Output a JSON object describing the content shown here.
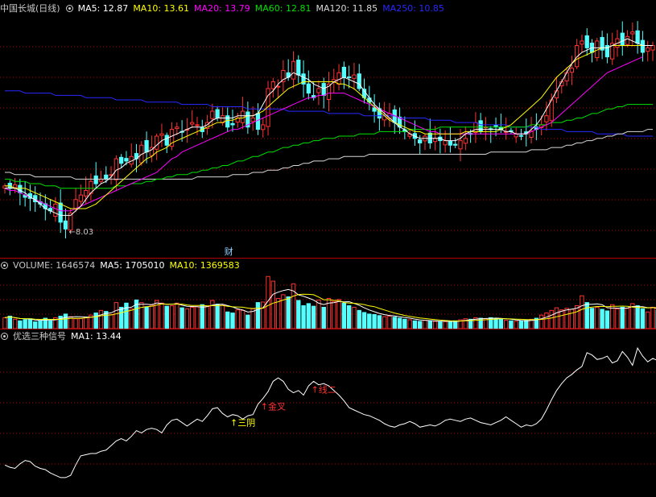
{
  "main_header": {
    "stock_name": "中国长城(日线)",
    "ma5": "MA5: 12.87",
    "ma10": "MA10: 13.61",
    "ma20": "MA20: 13.79",
    "ma60": "MA60: 12.81",
    "ma120": "MA120: 11.85",
    "ma250": "MA250: 10.85"
  },
  "vol_header": {
    "volume": "VOLUME: 1646574",
    "ma5": "MA5: 1705010",
    "ma10": "MA10: 1369583"
  },
  "ind_header": {
    "name": "优选三种信号",
    "ma1": "MA1: 13.44"
  },
  "colors": {
    "up": "#ff3232",
    "down": "#54ffff",
    "ma5": "#ffffff",
    "ma10": "#ffff00",
    "ma20": "#ff00ff",
    "ma60": "#00e000",
    "ma120": "#d8d8d8",
    "ma250": "#2828ff",
    "grid": "#b40000"
  },
  "chart_data": [
    {
      "type": "candlestick",
      "title": "中国长城(日线)",
      "ylim": [
        7.0,
        17.6
      ],
      "low_marker": {
        "label": "←8.03",
        "value": 8.03
      },
      "event_marker": {
        "label": "财",
        "x": 44
      },
      "close": [
        10.1,
        10.0,
        10.15,
        9.8,
        9.6,
        9.55,
        9.4,
        9.3,
        9.1,
        9.0,
        9.3,
        8.5,
        8.2,
        8.9,
        9.5,
        9.7,
        9.9,
        10.3,
        10.2,
        10.4,
        10.4,
        10.6,
        11.3,
        11.1,
        11.2,
        11.4,
        11.3,
        11.9,
        11.6,
        11.8,
        12.3,
        12.4,
        11.9,
        12.6,
        12.7,
        12.5,
        12.6,
        12.9,
        12.8,
        12.5,
        12.9,
        13.4,
        13.1,
        13.2,
        12.7,
        12.8,
        13.1,
        13.4,
        12.7,
        13.1,
        12.6,
        12.8,
        14.4,
        14.7,
        14.5,
        15.2,
        14.9,
        15.6,
        15.0,
        14.6,
        14.2,
        14.0,
        14.4,
        14.1,
        14.6,
        14.8,
        15.1,
        14.9,
        14.9,
        15.0,
        14.4,
        14.0,
        13.8,
        13.4,
        13.1,
        13.2,
        13.3,
        12.9,
        12.7,
        12.5,
        12.4,
        12.2,
        12.0,
        12.3,
        12.0,
        12.2,
        12.1,
        12.1,
        11.9,
        11.9,
        12.1,
        12.2,
        12.4,
        12.9,
        12.5,
        12.7,
        12.6,
        12.7,
        12.6,
        12.5,
        12.5,
        12.4,
        12.3,
        12.4,
        12.5,
        12.6,
        12.8,
        13.2,
        13.9,
        14.3,
        14.7,
        15.1,
        15.3,
        16.3,
        16.5,
        16.2,
        16.0,
        16.5,
        16.1,
        15.8,
        16.4,
        16.6,
        16.3,
        16.7,
        16.9,
        16.4,
        16.0,
        16.2,
        16.3
      ],
      "ma": {
        "ma5": [
          10.0,
          10.0,
          10.0,
          9.9,
          9.8,
          9.6,
          9.5,
          9.3,
          9.1,
          9.0,
          8.9,
          8.8,
          8.8,
          8.8,
          9.0,
          9.2,
          9.5,
          9.8,
          10.0,
          10.2,
          10.3,
          10.5,
          10.8,
          10.9,
          11.1,
          11.2,
          11.3,
          11.5,
          11.6,
          11.7,
          11.9,
          12.1,
          12.2,
          12.3,
          12.4,
          12.5,
          12.6,
          12.7,
          12.7,
          12.7,
          12.8,
          13.0,
          13.1,
          13.1,
          13.1,
          13.1,
          13.2,
          13.2,
          13.2,
          13.2,
          13.3,
          13.7,
          14.1,
          14.3,
          14.6,
          14.8,
          14.9,
          15.1,
          15.0,
          14.9,
          14.8,
          14.6,
          14.5,
          14.4,
          14.5,
          14.7,
          14.8,
          14.9,
          14.8,
          14.7,
          14.6,
          14.3,
          14.0,
          13.7,
          13.5,
          13.3,
          13.1,
          12.9,
          12.7,
          12.6,
          12.4,
          12.3,
          12.2,
          12.2,
          12.2,
          12.2,
          12.2,
          12.1,
          12.1,
          12.1,
          12.2,
          12.4,
          12.5,
          12.6,
          12.6,
          12.6,
          12.6,
          12.6,
          12.6,
          12.5,
          12.5,
          12.4,
          12.4,
          12.4,
          12.6,
          12.8,
          13.1,
          13.5,
          13.9,
          14.3,
          14.7,
          15.1,
          15.5,
          15.8,
          16.0,
          16.1,
          16.2,
          16.2,
          16.2,
          16.2,
          16.3,
          16.4,
          16.5,
          16.6,
          16.5,
          16.4,
          16.3,
          16.3,
          16.3
        ],
        "ma10": [
          10.1,
          10.1,
          10.0,
          10.0,
          10.0,
          9.9,
          9.8,
          9.7,
          9.6,
          9.5,
          9.4,
          9.3,
          9.2,
          9.1,
          9.1,
          9.1,
          9.1,
          9.2,
          9.3,
          9.5,
          9.7,
          9.9,
          10.1,
          10.3,
          10.5,
          10.7,
          10.9,
          11.1,
          11.3,
          11.4,
          11.6,
          11.7,
          11.8,
          12.0,
          12.1,
          12.2,
          12.3,
          12.4,
          12.5,
          12.6,
          12.7,
          12.8,
          12.9,
          12.9,
          13.0,
          13.0,
          13.1,
          13.1,
          13.2,
          13.2,
          13.3,
          13.4,
          13.6,
          13.8,
          14.0,
          14.2,
          14.4,
          14.5,
          14.6,
          14.7,
          14.7,
          14.7,
          14.7,
          14.7,
          14.7,
          14.7,
          14.6,
          14.6,
          14.5,
          14.4,
          14.2,
          14.0,
          13.8,
          13.6,
          13.4,
          13.2,
          13.0,
          12.9,
          12.8,
          12.7,
          12.6,
          12.5,
          12.5,
          12.4,
          12.4,
          12.4,
          12.4,
          12.4,
          12.4,
          12.4,
          12.4,
          12.5,
          12.5,
          12.5,
          12.5,
          12.5,
          12.5,
          12.5,
          12.6,
          12.7,
          12.8,
          13.0,
          13.2,
          13.4,
          13.6,
          13.8,
          14.0,
          14.3,
          14.6,
          14.9,
          15.1,
          15.3,
          15.5,
          15.7,
          15.8,
          15.9,
          16.0,
          16.1,
          16.2,
          16.2,
          16.3,
          16.3,
          16.3,
          16.3,
          16.3,
          16.3,
          16.3
        ],
        "ma20": [
          10.0,
          9.9,
          9.9,
          9.8,
          9.7,
          9.6,
          9.5,
          9.4,
          9.3,
          9.2,
          9.1,
          9.0,
          9.0,
          9.0,
          9.1,
          9.2,
          9.3,
          9.4,
          9.5,
          9.6,
          9.7,
          9.8,
          9.9,
          10.0,
          10.1,
          10.2,
          10.3,
          10.4,
          10.5,
          10.6,
          10.7,
          10.9,
          11.1,
          11.3,
          11.4,
          11.6,
          11.7,
          11.8,
          11.9,
          12.0,
          12.1,
          12.2,
          12.3,
          12.4,
          12.5,
          12.6,
          12.6,
          12.7,
          12.8,
          12.9,
          13.0,
          13.1,
          13.2,
          13.3,
          13.4,
          13.5,
          13.6,
          13.7,
          13.8,
          13.9,
          14.0,
          14.0,
          14.1,
          14.1,
          14.2,
          14.2,
          14.2,
          14.2,
          14.1,
          14.0,
          13.9,
          13.8,
          13.7,
          13.6,
          13.5,
          13.4,
          13.3,
          13.2,
          13.1,
          13.0,
          12.9,
          12.8,
          12.7,
          12.6,
          12.5,
          12.5,
          12.4,
          12.4,
          12.4,
          12.4,
          12.4,
          12.4,
          12.4,
          12.4,
          12.4,
          12.4,
          12.4,
          12.4,
          12.4,
          12.4,
          12.4,
          12.4,
          12.4,
          12.4,
          12.5,
          12.6,
          12.7,
          12.8,
          12.9,
          13.1,
          13.3,
          13.5,
          13.7,
          13.9,
          14.1,
          14.3,
          14.5,
          14.7,
          14.9,
          15.1,
          15.2,
          15.3,
          15.4,
          15.5,
          15.6,
          15.7,
          15.8
        ],
        "ma60": [
          10.4,
          10.4,
          10.3,
          10.3,
          10.3,
          10.2,
          10.2,
          10.2,
          10.1,
          10.1,
          10.1,
          10.0,
          10.0,
          10.0,
          10.0,
          10.0,
          10.0,
          10.0,
          10.0,
          10.0,
          10.0,
          10.0,
          10.1,
          10.1,
          10.1,
          10.2,
          10.2,
          10.2,
          10.3,
          10.3,
          10.4,
          10.4,
          10.5,
          10.5,
          10.6,
          10.6,
          10.6,
          10.7,
          10.7,
          10.8,
          10.8,
          10.9,
          10.9,
          11.0,
          11.0,
          11.1,
          11.2,
          11.2,
          11.3,
          11.4,
          11.4,
          11.5,
          11.6,
          11.6,
          11.7,
          11.8,
          11.8,
          11.9,
          11.9,
          12.0,
          12.0,
          12.1,
          12.1,
          12.2,
          12.2,
          12.2,
          12.3,
          12.3,
          12.3,
          12.3,
          12.4,
          12.4,
          12.4,
          12.4,
          12.5,
          12.5,
          12.5,
          12.5,
          12.5,
          12.5,
          12.6,
          12.6,
          12.6,
          12.6,
          12.6,
          12.6,
          12.7,
          12.7,
          12.7,
          12.7,
          12.7,
          12.7,
          12.7,
          12.7,
          12.7,
          12.7,
          12.7,
          12.7,
          12.7,
          12.7,
          12.7,
          12.7,
          12.7,
          12.7,
          12.8,
          12.8,
          12.8,
          12.8,
          12.9,
          12.9,
          12.9,
          13.0,
          13.0,
          13.1,
          13.1,
          13.2,
          13.3,
          13.3,
          13.4,
          13.5,
          13.5,
          13.6,
          13.6,
          13.7,
          13.7,
          13.7,
          13.7,
          13.7,
          13.7
        ],
        "ma120": [
          10.7,
          10.7,
          10.6,
          10.6,
          10.6,
          10.6,
          10.5,
          10.5,
          10.5,
          10.5,
          10.5,
          10.5,
          10.5,
          10.5,
          10.4,
          10.4,
          10.4,
          10.4,
          10.4,
          10.4,
          10.4,
          10.4,
          10.4,
          10.4,
          10.4,
          10.4,
          10.4,
          10.4,
          10.4,
          10.4,
          10.4,
          10.4,
          10.4,
          10.4,
          10.4,
          10.4,
          10.4,
          10.4,
          10.5,
          10.5,
          10.5,
          10.5,
          10.5,
          10.5,
          10.5,
          10.6,
          10.6,
          10.6,
          10.6,
          10.7,
          10.7,
          10.7,
          10.8,
          10.8,
          10.8,
          10.9,
          10.9,
          11.0,
          11.0,
          11.1,
          11.1,
          11.2,
          11.2,
          11.2,
          11.3,
          11.3,
          11.3,
          11.4,
          11.4,
          11.4,
          11.4,
          11.4,
          11.5,
          11.5,
          11.5,
          11.5,
          11.5,
          11.5,
          11.5,
          11.5,
          11.5,
          11.5,
          11.5,
          11.5,
          11.5,
          11.5,
          11.5,
          11.5,
          11.5,
          11.5,
          11.5,
          11.5,
          11.5,
          11.5,
          11.5,
          11.5,
          11.6,
          11.6,
          11.6,
          11.6,
          11.6,
          11.6,
          11.6,
          11.6,
          11.7,
          11.7,
          11.7,
          11.7,
          11.8,
          11.8,
          11.8,
          11.9,
          11.9,
          12.0,
          12.0,
          12.1,
          12.1,
          12.2,
          12.2,
          12.3,
          12.3,
          12.4,
          12.4,
          12.5,
          12.5,
          12.5,
          12.5,
          12.6,
          12.6
        ],
        "ma250": [
          14.3,
          14.3,
          14.3,
          14.3,
          14.2,
          14.2,
          14.2,
          14.2,
          14.2,
          14.2,
          14.1,
          14.1,
          14.1,
          14.1,
          14.1,
          14.1,
          14.0,
          14.0,
          14.0,
          14.0,
          14.0,
          14.0,
          13.9,
          13.9,
          13.9,
          13.9,
          13.9,
          13.9,
          13.8,
          13.8,
          13.8,
          13.8,
          13.8,
          13.8,
          13.8,
          13.7,
          13.7,
          13.7,
          13.7,
          13.7,
          13.7,
          13.6,
          13.6,
          13.6,
          13.6,
          13.6,
          13.6,
          13.6,
          13.5,
          13.5,
          13.5,
          13.5,
          13.5,
          13.5,
          13.5,
          13.5,
          13.4,
          13.4,
          13.4,
          13.4,
          13.4,
          13.4,
          13.4,
          13.4,
          13.3,
          13.3,
          13.3,
          13.3,
          13.3,
          13.3,
          13.3,
          13.2,
          13.2,
          13.2,
          13.2,
          13.2,
          13.2,
          13.2,
          13.1,
          13.1,
          13.1,
          13.1,
          13.1,
          13.1,
          13.0,
          13.0,
          13.0,
          13.0,
          13.0,
          12.9,
          12.9,
          12.9,
          12.9,
          12.9,
          12.8,
          12.8,
          12.8,
          12.8,
          12.8,
          12.8,
          12.7,
          12.7,
          12.7,
          12.7,
          12.7,
          12.7,
          12.6,
          12.6,
          12.6,
          12.6,
          12.6,
          12.5,
          12.5,
          12.5,
          12.5,
          12.5,
          12.5,
          12.4,
          12.4,
          12.4,
          12.4,
          12.4,
          12.4,
          12.3,
          12.3,
          12.3,
          12.3,
          12.3,
          12.3
        ]
      }
    },
    {
      "type": "bar",
      "title": "VOLUME",
      "ylim": [
        0,
        2100000
      ],
      "values": [
        420000,
        480000,
        360000,
        300000,
        340000,
        380000,
        260000,
        310000,
        400000,
        300000,
        420000,
        480000,
        560000,
        460000,
        380000,
        390000,
        440000,
        520000,
        600000,
        700000,
        660000,
        540000,
        1000000,
        820000,
        980000,
        760000,
        1100000,
        1000000,
        840000,
        900000,
        1080000,
        980000,
        860000,
        880000,
        980000,
        800000,
        760000,
        820000,
        840000,
        920000,
        860000,
        1080000,
        940000,
        900000,
        640000,
        600000,
        720000,
        700000,
        520000,
        760000,
        1000000,
        1020000,
        2000000,
        1820000,
        1160000,
        1300000,
        1220000,
        1720000,
        1080000,
        880000,
        960000,
        860000,
        1100000,
        820000,
        1160000,
        1040000,
        1120000,
        980000,
        880000,
        820000,
        700000,
        620000,
        560000,
        540000,
        500000,
        460000,
        480000,
        440000,
        400000,
        360000,
        340000,
        300000,
        280000,
        320000,
        300000,
        280000,
        260000,
        270000,
        280000,
        300000,
        340000,
        380000,
        360000,
        420000,
        400000,
        380000,
        420000,
        400000,
        360000,
        320000,
        300000,
        280000,
        300000,
        320000,
        360000,
        400000,
        520000,
        600000,
        700000,
        800000,
        720000,
        780000,
        740000,
        880000,
        1260000,
        1000000,
        780000,
        820000,
        740000,
        680000,
        920000,
        760000,
        820000,
        780000,
        960000,
        880000,
        760000,
        640000,
        820000,
        700000
      ]
    },
    {
      "type": "line",
      "title": "优选三种信号",
      "ylim": [
        5.0,
        18.0
      ],
      "annotations": [
        {
          "label": "↑三阴",
          "x": 45
        },
        {
          "label": "↑金叉",
          "x": 51
        },
        {
          "label": "↑线二",
          "x": 61
        }
      ],
      "values": [
        7.3,
        7.1,
        7.0,
        7.4,
        7.7,
        7.6,
        7.2,
        7.0,
        6.9,
        6.6,
        6.4,
        6.2,
        6.2,
        6.4,
        7.3,
        8.1,
        8.2,
        8.3,
        8.3,
        8.5,
        8.6,
        9.0,
        9.4,
        9.6,
        9.4,
        9.8,
        10.3,
        10.1,
        10.4,
        10.5,
        10.4,
        10.1,
        10.8,
        11.2,
        11.3,
        11.0,
        10.7,
        11.0,
        11.3,
        11.1,
        11.6,
        12.2,
        12.3,
        11.8,
        11.5,
        11.7,
        11.6,
        11.3,
        11.6,
        11.7,
        12.6,
        13.1,
        13.7,
        14.6,
        14.9,
        14.6,
        13.9,
        13.6,
        13.8,
        13.4,
        14.2,
        14.6,
        14.3,
        14.4,
        14.2,
        13.8,
        13.4,
        12.9,
        12.3,
        12.1,
        11.9,
        11.7,
        11.6,
        11.4,
        11.2,
        10.9,
        10.7,
        10.6,
        10.8,
        10.9,
        11.1,
        10.9,
        10.6,
        10.7,
        10.8,
        10.7,
        10.9,
        11.2,
        11.3,
        11.2,
        11.1,
        11.3,
        11.4,
        11.2,
        11.0,
        10.9,
        10.8,
        11.0,
        11.2,
        11.5,
        11.2,
        10.9,
        10.6,
        10.8,
        10.7,
        10.9,
        11.3,
        12.1,
        13.0,
        13.8,
        14.4,
        14.9,
        15.2,
        15.6,
        15.9,
        17.1,
        16.9,
        16.5,
        16.6,
        16.8,
        16.2,
        16.4,
        17.2,
        16.7,
        16.0,
        17.5,
        16.8,
        16.3,
        16.6,
        16.4
      ]
    }
  ]
}
